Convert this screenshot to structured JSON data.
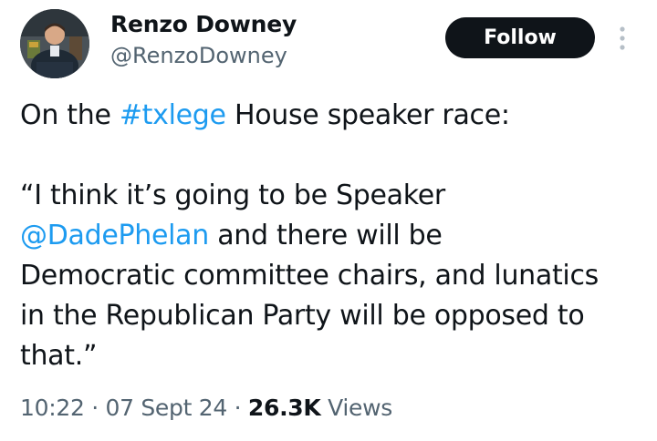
{
  "author": {
    "display_name": "Renzo Downey",
    "handle": "@RenzoDowney"
  },
  "follow_button": {
    "label": "Follow"
  },
  "tweet": {
    "line1_before": "On the ",
    "hashtag": "#txlege",
    "line1_after": " House speaker race:",
    "quote_line1": "“I think it’s going to be Speaker",
    "mention": "@DadePhelan",
    "quote_line2_after": " and there will be",
    "quote_line3": "Democratic committee chairs, and lunatics",
    "quote_line4": "in the Republican Party will be opposed to",
    "quote_line5": "that.”"
  },
  "meta": {
    "time": "10:22",
    "separator": " · ",
    "date": "07 Sept 24",
    "views_count": "26.3K",
    "views_label": " Views"
  },
  "colors": {
    "link": "#1d9bf0",
    "secondary_text": "#536471",
    "primary_text": "#0f1419",
    "button_bg": "#0f1419"
  },
  "icons": {
    "more": "more-vertical-icon"
  }
}
